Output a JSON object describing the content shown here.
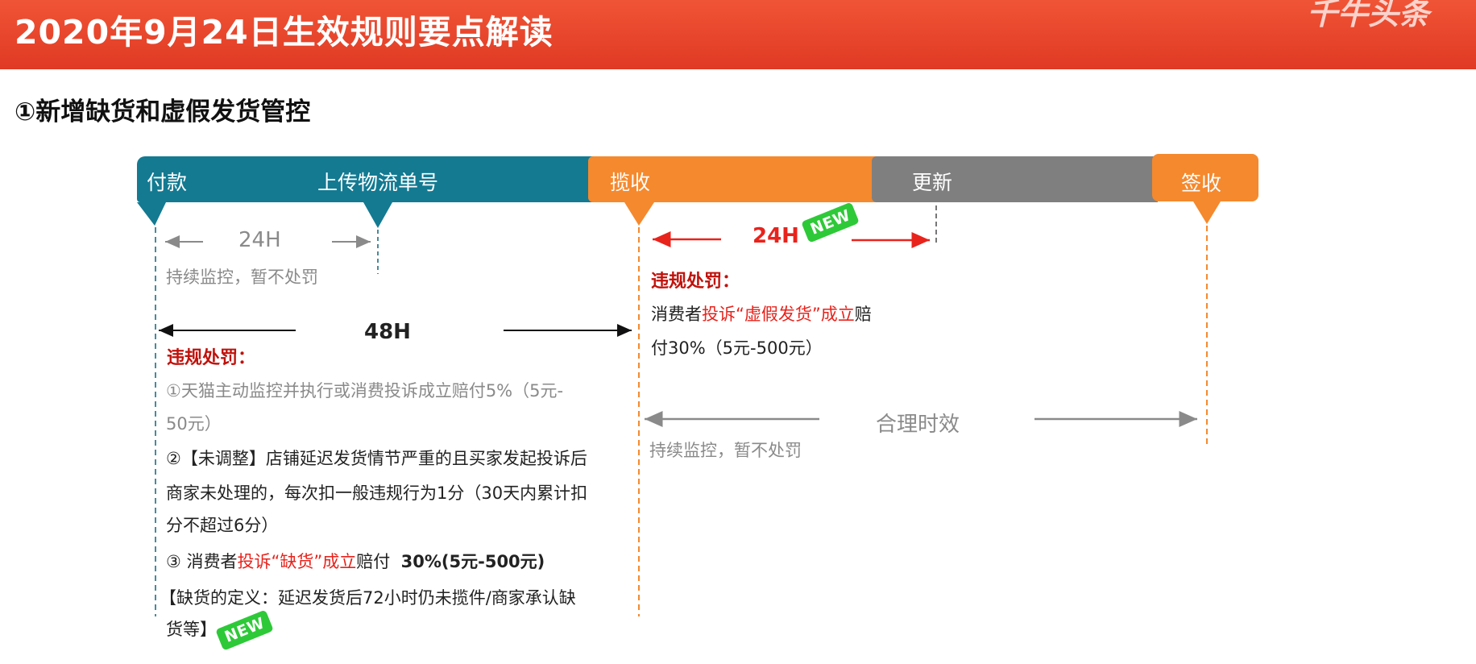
{
  "banner": {
    "title": "2020年9月24日生效规则要点解读",
    "watermark": "千牛头条",
    "bg_color": "#e8432b"
  },
  "section": {
    "title": "①新增缺货和虚假发货管控"
  },
  "timeline": {
    "stages": [
      {
        "label": "付款",
        "color": "#137a92"
      },
      {
        "label": "上传物流单号",
        "color": "#137a92"
      },
      {
        "label": "揽收",
        "color": "#f5892d"
      },
      {
        "label": "更新",
        "color": "#7f7f7f"
      },
      {
        "label": "签收",
        "color": "#f5892d"
      }
    ]
  },
  "left_block": {
    "interval_24h": "24H",
    "monitor_note": "持续监控，暂不处罚",
    "interval_48h": "48H",
    "penalty_heading": "违规处罚：",
    "rule1_line1": "①天猫主动监控并执行或消费投诉成立赔付5%（5元-",
    "rule1_line2": "50元）",
    "rule2_line1": "②【未调整】店铺延迟发货情节严重的且买家发起投诉后",
    "rule2_line2": "商家未处理的，每次扣一般违规行为1分（30天内累计扣",
    "rule2_line3": "分不超过6分）",
    "rule3_prefix": "③ 消费者",
    "rule3_red": "投诉“缺货”成立",
    "rule3_mid": "赔付",
    "rule3_bold": "30%(5元-500元)",
    "def_line1": "【缺货的定义：延迟发货后72小时仍未揽件/商家承认缺",
    "def_line2": "货等】",
    "new_badge": "NEW"
  },
  "right_block": {
    "interval_24h": "24H",
    "new_badge": "NEW",
    "penalty_heading": "违规处罚：",
    "line1_prefix": "消费者",
    "line1_red": "投诉“虚假发货”成立",
    "line1_suffix": "赔",
    "line2": "付30%（5元-500元）",
    "reasonable_time": "合理时效",
    "monitor_note": "持续监控，暂不处罚"
  },
  "colors": {
    "teal": "#137a92",
    "orange": "#f5892d",
    "gray": "#7f7f7f",
    "red": "#e8231c",
    "new_green": "#2ec938"
  }
}
